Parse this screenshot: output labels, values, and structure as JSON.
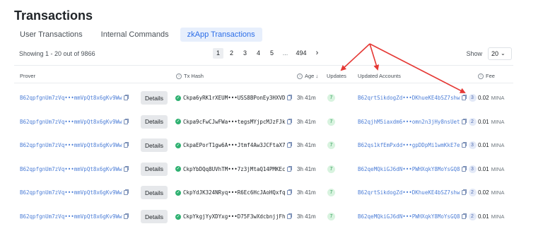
{
  "page": {
    "title": "Transactions"
  },
  "tabs": [
    {
      "label": "User Transactions"
    },
    {
      "label": "Internal Commands"
    },
    {
      "label": "zkApp Transactions"
    }
  ],
  "pagination": {
    "showing": "Showing 1 - 20 out of 9866",
    "pages": [
      "1",
      "2",
      "3",
      "4",
      "5"
    ],
    "ellipsis": "...",
    "last": "494",
    "next": "›",
    "current_page": "1"
  },
  "page_size": {
    "label": "Show",
    "value": "20",
    "chevron": "⌄"
  },
  "columns": {
    "prover": "Prover",
    "tx_hash": "Tx Hash",
    "age": "Age ↓",
    "updates": "Updates",
    "updated_accounts": "Updated Accounts",
    "fee": "Fee"
  },
  "rows": [
    {
      "prover": "B62qpfgnUm7zVq•••mmVpQt8x6gKv9Ww",
      "details": "Details",
      "tx_hash": "Ckpa6yRK1rXEUM•••USS8BPonEy3HXVD",
      "age": "3h 41m",
      "updates": "7",
      "account": "B62qrtSikdogZd•••DKhueKE4bSZ7shw",
      "account_count": "3",
      "fee": "0.02",
      "fee_unit": "MINA"
    },
    {
      "prover": "B62qpfgnUm7zVq•••mmVpQt8x6gKv9Ww",
      "details": "Details",
      "tx_hash": "Ckpa9cFwCJwFWa•••tegsMYjpcMJzFJk",
      "age": "3h 41m",
      "updates": "7",
      "account": "B62qjhM5iaxdm6•••omn2n3jHy8nsUet",
      "account_count": "2",
      "fee": "0.01",
      "fee_unit": "MINA"
    },
    {
      "prover": "B62qpfgnUm7zVq•••mmVpQt8x6gKv9Ww",
      "details": "Details",
      "tx_hash": "CkpaEPorT1gw6A•••Jtmf4Aw3JCFtaX7",
      "age": "3h 41m",
      "updates": "7",
      "account": "B62qs1kfEmPxdd•••gpDDpMi1wmKkE7e",
      "account_count": "3",
      "fee": "0.01",
      "fee_unit": "MINA"
    },
    {
      "prover": "B62qpfgnUm7zVq•••mmVpQt8x6gKv9Ww",
      "details": "Details",
      "tx_hash": "CkpYbDQq8UVhTM•••7z3jMtaQ14PMKEc",
      "age": "3h 41m",
      "updates": "7",
      "account": "B62qeMQkiGJ6dN•••PWHXqkY8MoYsGQ8",
      "account_count": "3",
      "fee": "0.01",
      "fee_unit": "MINA"
    },
    {
      "prover": "B62qpfgnUm7zVq•••mmVpQt8x6gKv9Ww",
      "details": "Details",
      "tx_hash": "CkpYdJK324NRyq•••R6Ec6HcJAoHQxfq",
      "age": "3h 41m",
      "updates": "7",
      "account": "B62qrtSikdogZd•••DKhueKE4bSZ7shw",
      "account_count": "2",
      "fee": "0.02",
      "fee_unit": "MINA"
    },
    {
      "prover": "B62qpfgnUm7zVq•••mmVpQt8x6gKv9Ww",
      "details": "Details",
      "tx_hash": "CkpYkgjYyXDYxg•••D75F3wXdcbnjjFh",
      "age": "3h 41m",
      "updates": "7",
      "account": "B62qeMQkiGJ6dN•••PWHXqkY8MoYsGQ8",
      "account_count": "2",
      "fee": "0.01",
      "fee_unit": "MINA"
    }
  ],
  "icons": {
    "copy": "copy-icon",
    "success": "check-circle-icon",
    "info": "info-icon"
  },
  "colors": {
    "link": "#4e7fd7",
    "active_tab_bg": "#e7effc",
    "active_tab_text": "#2c6ee8",
    "success": "#2fb171",
    "annotation_arrow": "#e53935"
  }
}
